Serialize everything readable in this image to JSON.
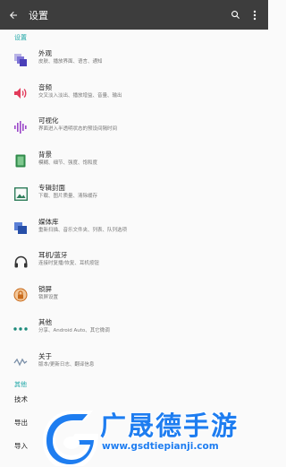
{
  "appbar": {
    "title": "设置"
  },
  "sections": {
    "settings": "设置",
    "other": "其他"
  },
  "items": [
    {
      "title": "外观",
      "subtitle": "皮肤、播放界面、语言、通知",
      "icon": "appearance-icon"
    },
    {
      "title": "音频",
      "subtitle": "交叉淡入淡出、播放增益、音量、输出",
      "icon": "audio-icon"
    },
    {
      "title": "可视化",
      "subtitle": "界面进入半透明状态的预设间隔时间",
      "icon": "visualization-icon"
    },
    {
      "title": "背景",
      "subtitle": "模糊、细节、强度、饱和度",
      "icon": "background-icon"
    },
    {
      "title": "专辑封面",
      "subtitle": "下载、图片质量、清除缓存",
      "icon": "album-art-icon"
    },
    {
      "title": "媒体库",
      "subtitle": "重新扫描、音乐文件夹、列表、队列选项",
      "icon": "library-icon"
    },
    {
      "title": "耳机/蓝牙",
      "subtitle": "连接时复播/恢复、耳机按钮",
      "icon": "headphones-icon"
    },
    {
      "title": "锁屏",
      "subtitle": "锁屏设置",
      "icon": "lockscreen-icon"
    },
    {
      "title": "其他",
      "subtitle": "分享、Android Auto、其它微调",
      "icon": "more-icon"
    },
    {
      "title": "关于",
      "subtitle": "版本/更新日志、翻译信息",
      "icon": "about-icon"
    }
  ],
  "other_items": [
    {
      "label": "技术"
    },
    {
      "label": "导出"
    },
    {
      "label": "导入"
    }
  ],
  "watermark": {
    "brand": "广晟德手游",
    "url": "www.gsdtiepianji.com"
  }
}
